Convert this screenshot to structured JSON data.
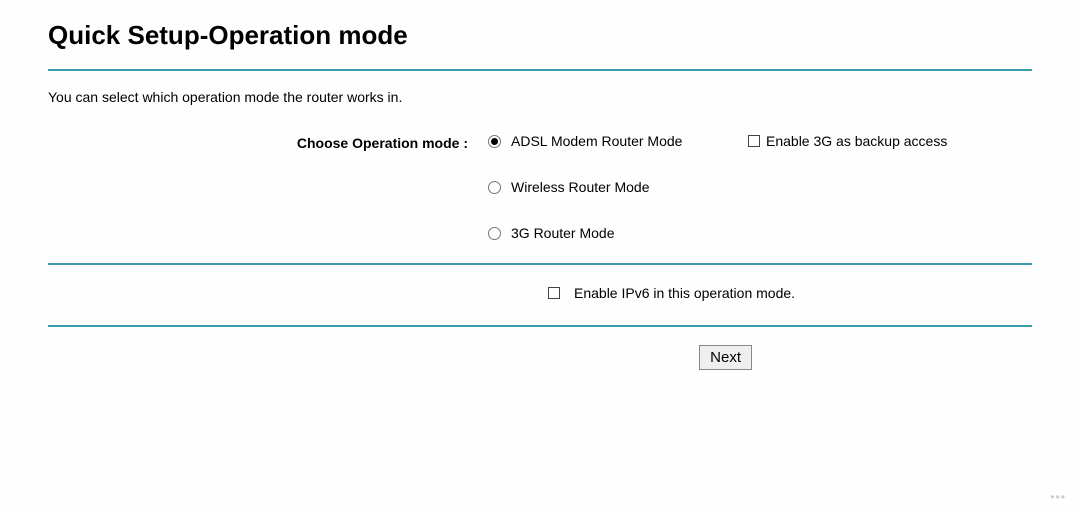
{
  "title": "Quick Setup-Operation mode",
  "intro": "You can select which operation mode the router works in.",
  "form": {
    "label": "Choose Operation mode :",
    "options": [
      {
        "label": "ADSL Modem Router Mode",
        "checked": true
      },
      {
        "label": "Wireless Router Mode",
        "checked": false
      },
      {
        "label": "3G Router Mode",
        "checked": false
      }
    ],
    "backup_label": "Enable 3G as backup access",
    "ipv6_label": "Enable IPv6 in this operation mode."
  },
  "buttons": {
    "next": "Next"
  }
}
